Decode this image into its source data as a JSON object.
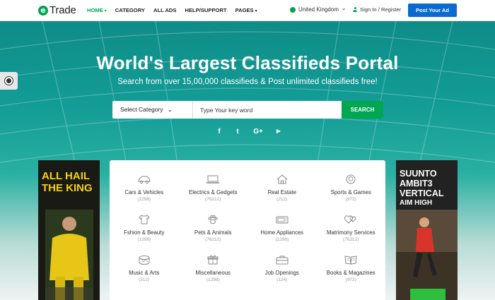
{
  "header": {
    "logo_mark": "e",
    "logo_text": "Trade",
    "nav": [
      {
        "label": "HOME",
        "active": true,
        "caret": "▾"
      },
      {
        "label": "CATEGORY"
      },
      {
        "label": "ALL ADS"
      },
      {
        "label": "HELP/SUPPORT"
      },
      {
        "label": "PAGES",
        "caret": "▾"
      }
    ],
    "region": "United Kingdom",
    "region_caret": "⌄",
    "signin": "Sign In / Register",
    "post_ad": "Post Your Ad"
  },
  "hero": {
    "title": "World's Largest Classifieds Portal",
    "subtitle": "Search from over 15,00,000 classifieds & Post unlimited classifieds free!",
    "select_category": "Select Category",
    "select_caret": "⌄",
    "keyword_placeholder": "Type Your key word",
    "search_button": "SEARCH",
    "socials": [
      "f",
      "t",
      "G+",
      "▶"
    ]
  },
  "ads": {
    "left": {
      "line1": "ALL HAIL",
      "line2": "THE KING"
    },
    "right": {
      "line1": "SUUNTO",
      "line2": "AMBIT3",
      "line3": "VERTICAL",
      "line4": "AIM HIGH"
    }
  },
  "categories": [
    {
      "name": "Cars & Vehicles",
      "count": "(1298)",
      "icon": "car-icon"
    },
    {
      "name": "Electrics & Gedgets",
      "count": "(76212)",
      "icon": "laptop-icon"
    },
    {
      "name": "Real Estate",
      "count": "(212)",
      "icon": "house-icon"
    },
    {
      "name": "Sports & Games",
      "count": "(972)",
      "icon": "ball-icon"
    },
    {
      "name": "Fshion & Beauty",
      "count": "(1298)",
      "icon": "shirt-icon"
    },
    {
      "name": "Pets & Animals",
      "count": "(76212)",
      "icon": "paw-icon"
    },
    {
      "name": "Home Appliances",
      "count": "(1298)",
      "icon": "appliance-icon"
    },
    {
      "name": "Matrimony Services",
      "count": "(76212)",
      "icon": "hearts-icon"
    },
    {
      "name": "Music & Arts",
      "count": "(212)",
      "icon": "drum-icon"
    },
    {
      "name": "Miscellaneous",
      "count": "(1298)",
      "icon": "box-icon"
    },
    {
      "name": "Job Openings",
      "count": "(124)",
      "icon": "briefcase-icon"
    },
    {
      "name": "Books & Magazines",
      "count": "(972)",
      "icon": "book-icon"
    }
  ]
}
